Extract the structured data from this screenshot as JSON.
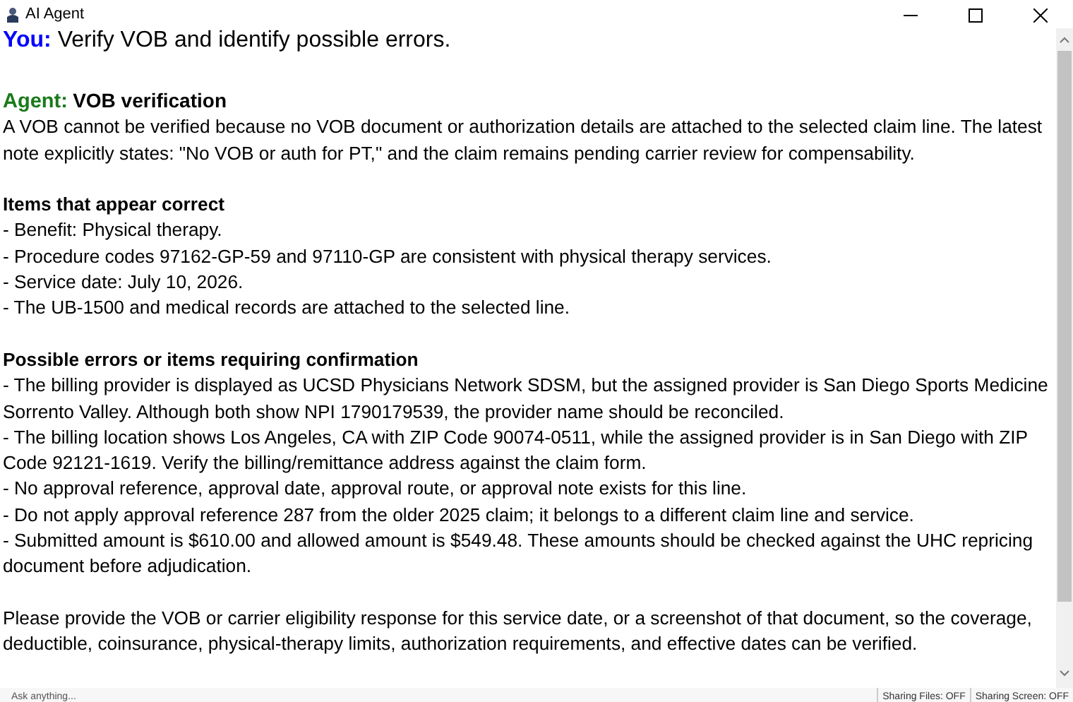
{
  "window": {
    "title": "AI Agent"
  },
  "user_message": {
    "speaker": "You:",
    "text": "Verify VOB and identify possible errors."
  },
  "agent_message": {
    "speaker": "Agent:",
    "title": "VOB verification",
    "blocks": [
      {
        "kind": "paragraph",
        "text": "A VOB cannot be verified because no VOB document or authorization details are attached to the selected claim line. The latest note explicitly states: \"No VOB or auth for PT,\" and the claim remains pending carrier review for compensability."
      },
      {
        "kind": "heading",
        "text": "Items that appear correct"
      },
      {
        "kind": "item",
        "text": "- Benefit: Physical therapy."
      },
      {
        "kind": "item",
        "text": "- Procedure codes 97162-GP-59 and 97110-GP are consistent with physical therapy services."
      },
      {
        "kind": "item",
        "text": "- Service date: July 10, 2026."
      },
      {
        "kind": "item",
        "text": "- The UB-1500 and medical records are attached to the selected line."
      },
      {
        "kind": "heading",
        "text": "Possible errors or items requiring confirmation"
      },
      {
        "kind": "item",
        "text": "- The billing provider is displayed as UCSD Physicians Network SDSM, but the assigned provider is San Diego Sports Medicine Sorrento Valley. Although both show NPI 1790179539, the provider name should be reconciled."
      },
      {
        "kind": "item",
        "text": "- The billing location shows Los Angeles, CA with ZIP Code 90074-0511, while the assigned provider is in San Diego with ZIP Code 92121-1619. Verify the billing/remittance address against the claim form."
      },
      {
        "kind": "item",
        "text": "- No approval reference, approval date, approval route, or approval note exists for this line."
      },
      {
        "kind": "item",
        "text": "- Do not apply approval reference 287 from the older 2025 claim; it belongs to a different claim line and service."
      },
      {
        "kind": "item",
        "text": "- Submitted amount is $610.00 and allowed amount is $549.48. These amounts should be checked against the UHC repricing document before adjudication."
      },
      {
        "kind": "paragraph",
        "text": "Please provide the VOB or carrier eligibility response for this service date, or a screenshot of that document, so the coverage, deductible, coinsurance, physical-therapy limits, authorization requirements, and effective dates can be verified."
      }
    ]
  },
  "input": {
    "placeholder": "Ask anything..."
  },
  "status": [
    "Sharing Files: OFF",
    "Sharing Screen: OFF"
  ]
}
